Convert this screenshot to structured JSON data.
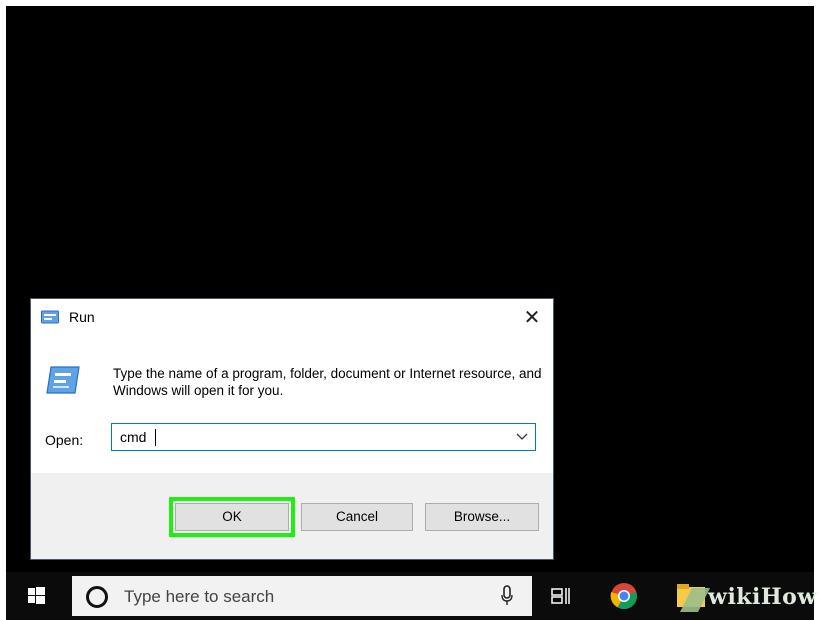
{
  "dialog": {
    "title": "Run",
    "description": "Type the name of a program, folder, document or Internet resource, and Windows will open it for you.",
    "open_label": "Open:",
    "open_value": "cmd",
    "buttons": {
      "ok": "OK",
      "cancel": "Cancel",
      "browse": "Browse..."
    },
    "highlight_color": "#22ee11"
  },
  "taskbar": {
    "search_placeholder": "Type here to search",
    "icons": [
      "windows-start-icon",
      "search-icon",
      "microphone-icon",
      "task-view-icon",
      "chrome-icon",
      "file-explorer-icon"
    ]
  },
  "watermark": {
    "text": "wikiHow"
  },
  "colors": {
    "desktop": "#000000",
    "taskbar": "#0b0b0b",
    "accent": "#0078d7"
  }
}
